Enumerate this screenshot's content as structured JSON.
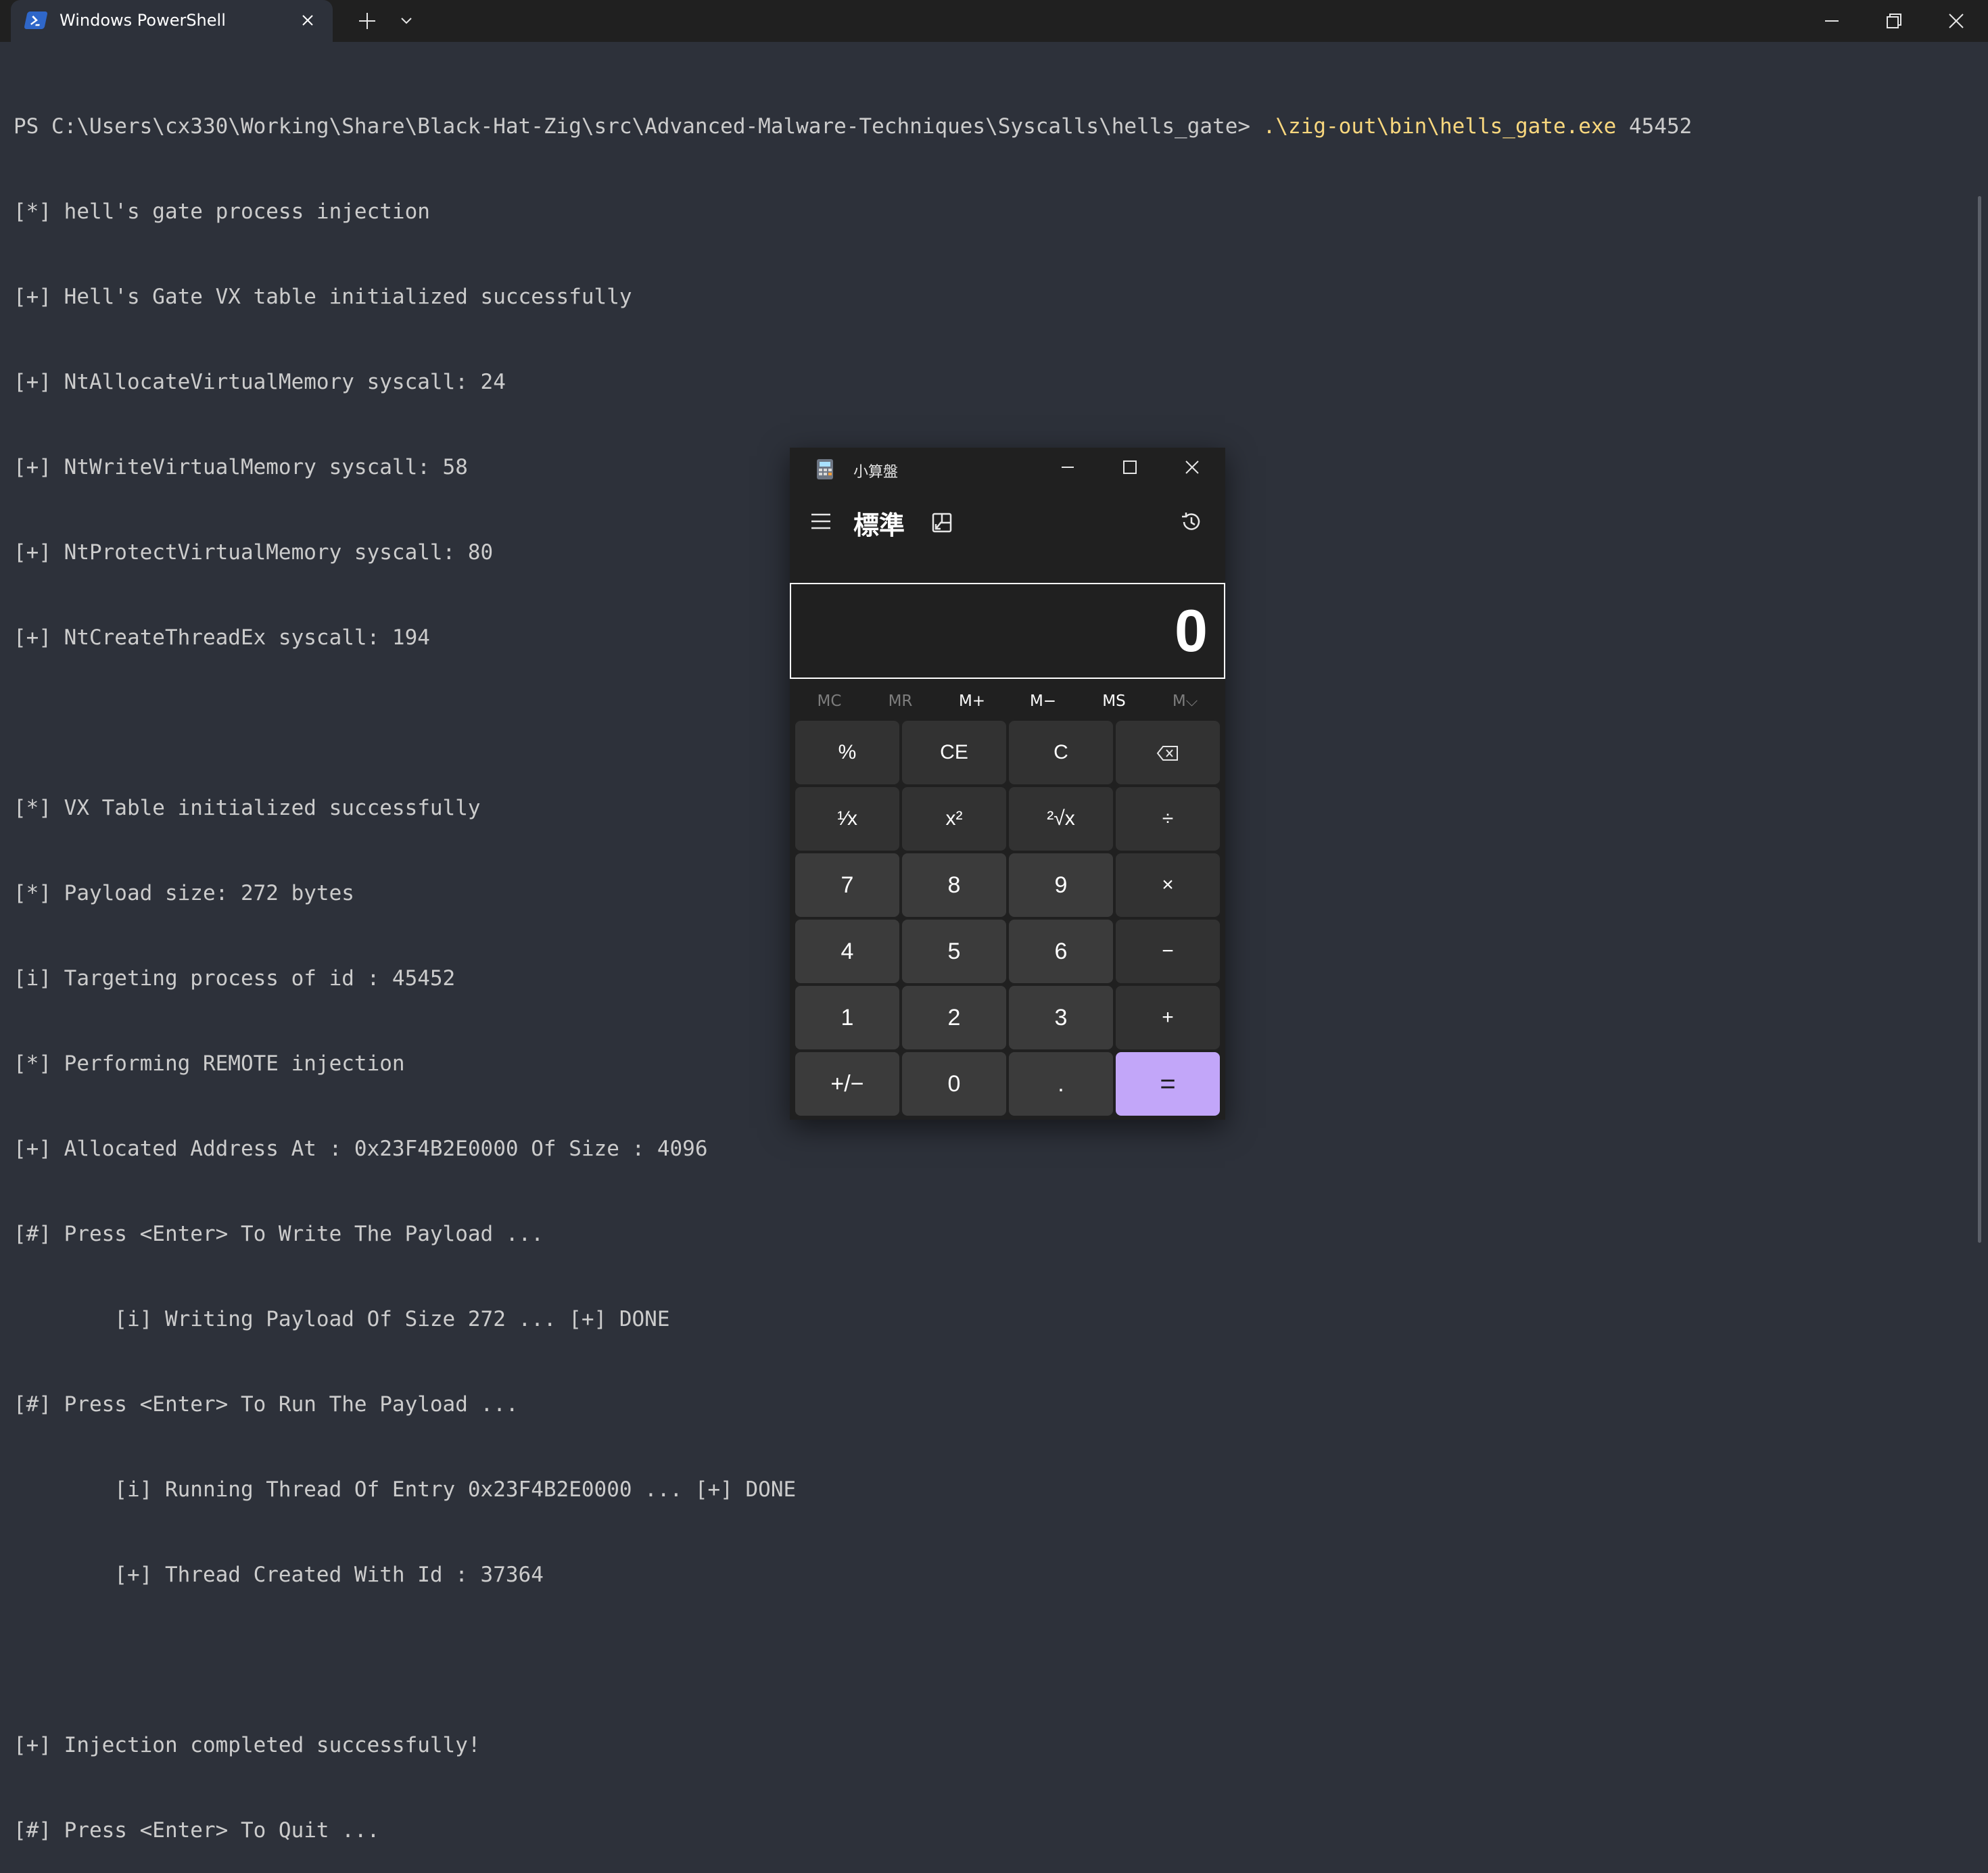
{
  "window": {
    "tab_title": "Windows PowerShell",
    "icons": {
      "tab_icon": "powershell-icon",
      "tab_close": "close-icon",
      "new_tab": "plus-icon",
      "tab_dropdown": "chevron-down-icon",
      "minimize": "minimize-icon",
      "restore": "restore-icon",
      "close": "close-icon"
    }
  },
  "terminal": {
    "prompt": "PS C:\\Users\\cx330\\Working\\Share\\Black-Hat-Zig\\src\\Advanced-Malware-Techniques\\Syscalls\\hells_gate> ",
    "command": ".\\zig-out\\bin\\hells_gate.exe",
    "argument": " 45452",
    "lines": [
      "[*] hell's gate process injection",
      "[+] Hell's Gate VX table initialized successfully",
      "[+] NtAllocateVirtualMemory syscall: 24",
      "[+] NtWriteVirtualMemory syscall: 58",
      "[+] NtProtectVirtualMemory syscall: 80",
      "[+] NtCreateThreadEx syscall: 194",
      "",
      "[*] VX Table initialized successfully",
      "[*] Payload size: 272 bytes",
      "[i] Targeting process of id : 45452",
      "[*] Performing REMOTE injection",
      "[+] Allocated Address At : 0x23F4B2E0000 Of Size : 4096",
      "[#] Press <Enter> To Write The Payload ...",
      "        [i] Writing Payload Of Size 272 ... [+] DONE",
      "[#] Press <Enter> To Run The Payload ...",
      "        [i] Running Thread Of Entry 0x23F4B2E0000 ... [+] DONE",
      "        [+] Thread Created With Id : 37364",
      "",
      "[+] Injection completed successfully!",
      "[#] Press <Enter> To Quit ..."
    ]
  },
  "calculator": {
    "title": "小算盤",
    "mode": "標準",
    "display": "0",
    "icons": {
      "app": "calculator-icon",
      "menu": "hamburger-menu-icon",
      "keep_on_top": "keep-on-top-icon",
      "history": "history-icon",
      "minimize": "minimize-icon",
      "maximize": "maximize-icon",
      "close": "close-icon"
    },
    "memory": [
      {
        "label": "MC",
        "enabled": false
      },
      {
        "label": "MR",
        "enabled": false
      },
      {
        "label": "M+",
        "enabled": true
      },
      {
        "label": "M−",
        "enabled": true
      },
      {
        "label": "MS",
        "enabled": true
      },
      {
        "label": "M⌵",
        "enabled": false
      }
    ],
    "keys": {
      "percent": "%",
      "clear_entry": "CE",
      "clear": "C",
      "backspace": "backspace-icon",
      "reciprocal": "¹⁄x",
      "square": "x²",
      "sqrt": "²√x",
      "divide": "÷",
      "seven": "7",
      "eight": "8",
      "nine": "9",
      "multiply": "×",
      "four": "4",
      "five": "5",
      "six": "6",
      "subtract": "−",
      "one": "1",
      "two": "2",
      "three": "3",
      "add": "+",
      "negate": "+/−",
      "zero": "0",
      "decimal": ".",
      "equals": "="
    },
    "colors": {
      "equals_accent": "#c2a6f9"
    }
  }
}
